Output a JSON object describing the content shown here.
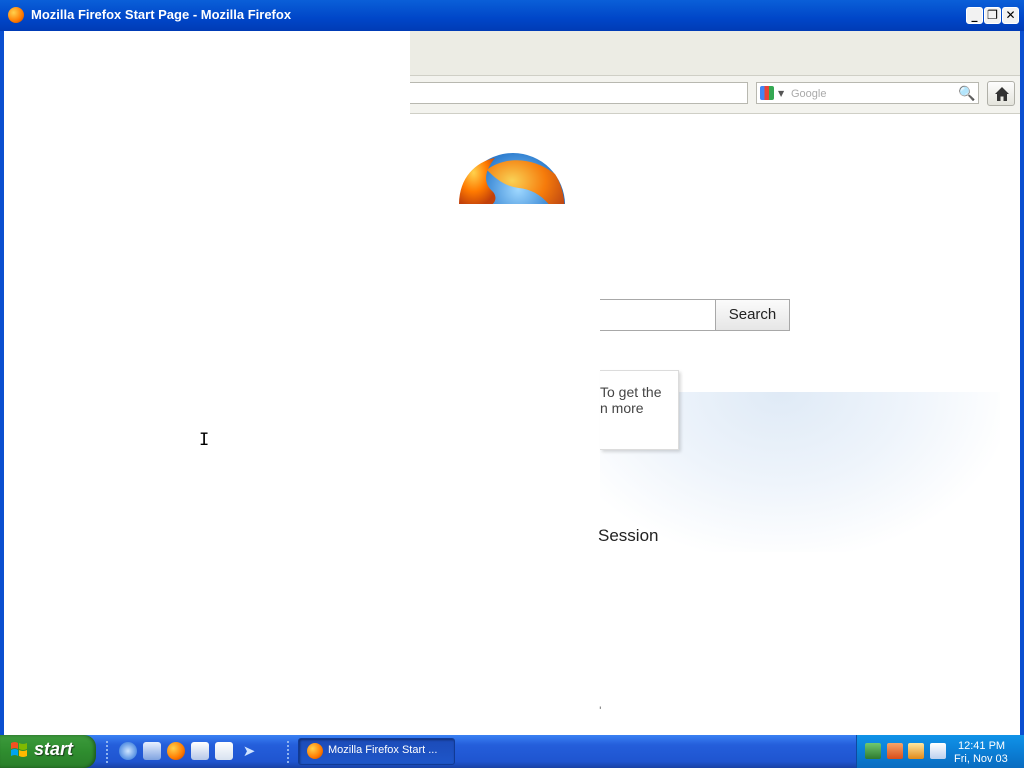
{
  "window": {
    "title": "Mozilla Firefox Start Page - Mozilla Firefox",
    "controls": {
      "minimize": "_",
      "restore": "❐",
      "close": "✕"
    }
  },
  "browser": {
    "search_placeholder": "Google",
    "search_engine_icon": "google-icon",
    "home_icon": "home-icon"
  },
  "page": {
    "search_button_label": "Search",
    "snippet_line1": "To get the",
    "snippet_line2": "n more",
    "session_text": "Session",
    "small_mark": "'"
  },
  "taskbar": {
    "start_label": "start",
    "quick_launch": [
      "ie-icon",
      "show-desktop-icon",
      "firefox-icon",
      "media-player-icon",
      "search-icon",
      "arrow-icon"
    ],
    "tasks": [
      {
        "label": "Mozilla Firefox Start ...",
        "icon": "firefox-icon"
      }
    ],
    "tray_icons": [
      "network-icon",
      "security-icon",
      "update-icon",
      "keyboard-icon"
    ],
    "clock_time": "12:41 PM",
    "clock_date": "Fri, Nov 03"
  },
  "cursor": "I"
}
